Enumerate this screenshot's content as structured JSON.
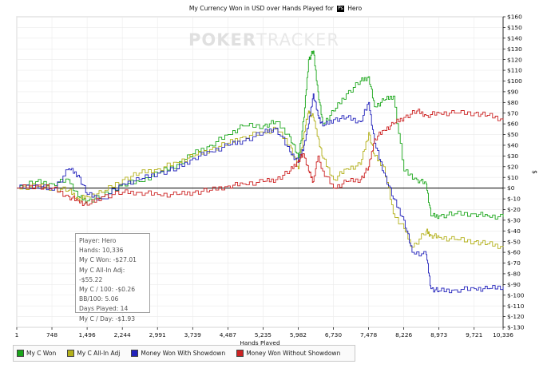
{
  "title": {
    "prefix": "My Currency Won in USD over Hands Played for",
    "player_tag": "Ps",
    "player": "Hero"
  },
  "watermark": {
    "bold": "POKER",
    "thin": "TRACKER"
  },
  "stats": {
    "player": "Player: Hero",
    "hands": "Hands: 10,336",
    "c_won": "My C Won: -$27.01",
    "allin_adj": "My C All-In Adj: -$55.22",
    "c_per_100": "My C / 100: -$0.26",
    "bb_100": "BB/100: 5.06",
    "days": "Days Played: 14",
    "c_per_day": "My C / Day: -$1.93"
  },
  "colors": {
    "green": "#1aa61a",
    "olive": "#b3b01a",
    "blue": "#2222bb",
    "red": "#cc2222",
    "grid": "#ebebeb",
    "axis": "#000000"
  },
  "chart_data": {
    "type": "line",
    "title": "My Currency Won in USD over Hands Played for Hero",
    "xlabel": "Hands Played",
    "ylabel": "$",
    "xlim": [
      1,
      10336
    ],
    "ylim": [
      -130,
      160
    ],
    "x_ticks": [
      "1",
      "748",
      "1,496",
      "2,244",
      "2,991",
      "3,739",
      "4,487",
      "5,235",
      "5,982",
      "6,730",
      "7,478",
      "8,226",
      "8,973",
      "9,721",
      "10,336"
    ],
    "y_ticks": [
      "$160",
      "$150",
      "$140",
      "$130",
      "$120",
      "$110",
      "$100",
      "$90",
      "$80",
      "$70",
      "$60",
      "$50",
      "$40",
      "$30",
      "$20",
      "$10",
      "$0",
      "$-10",
      "$-20",
      "$-30",
      "$-40",
      "$-50",
      "$-60",
      "$-70",
      "$-80",
      "$-90",
      "$-100",
      "$-110",
      "$-120",
      "$-130"
    ],
    "legend_position": "bottom",
    "series": [
      {
        "name": "My C Won",
        "color": "#1aa61a",
        "points": [
          [
            1,
            0
          ],
          [
            400,
            6
          ],
          [
            748,
            4
          ],
          [
            1100,
            8
          ],
          [
            1300,
            -8
          ],
          [
            1496,
            -12
          ],
          [
            1800,
            -8
          ],
          [
            2244,
            4
          ],
          [
            2600,
            6
          ],
          [
            2991,
            14
          ],
          [
            3400,
            22
          ],
          [
            3739,
            32
          ],
          [
            4100,
            40
          ],
          [
            4487,
            50
          ],
          [
            4800,
            58
          ],
          [
            5235,
            58
          ],
          [
            5500,
            62
          ],
          [
            5800,
            48
          ],
          [
            5982,
            28
          ],
          [
            6100,
            66
          ],
          [
            6200,
            120
          ],
          [
            6300,
            128
          ],
          [
            6400,
            90
          ],
          [
            6500,
            60
          ],
          [
            6730,
            72
          ],
          [
            7000,
            88
          ],
          [
            7300,
            100
          ],
          [
            7478,
            104
          ],
          [
            7600,
            76
          ],
          [
            7800,
            82
          ],
          [
            8000,
            86
          ],
          [
            8226,
            16
          ],
          [
            8500,
            8
          ],
          [
            8700,
            4
          ],
          [
            8800,
            -26
          ],
          [
            8973,
            -26
          ],
          [
            9300,
            -24
          ],
          [
            9721,
            -24
          ],
          [
            10000,
            -26
          ],
          [
            10336,
            -27
          ]
        ]
      },
      {
        "name": "My C All-In Adj",
        "color": "#b3b01a",
        "points": [
          [
            1,
            0
          ],
          [
            400,
            2
          ],
          [
            748,
            0
          ],
          [
            1100,
            -2
          ],
          [
            1300,
            -10
          ],
          [
            1496,
            -8
          ],
          [
            1800,
            -4
          ],
          [
            2244,
            8
          ],
          [
            2600,
            14
          ],
          [
            2991,
            18
          ],
          [
            3400,
            24
          ],
          [
            3739,
            30
          ],
          [
            4100,
            36
          ],
          [
            4487,
            42
          ],
          [
            4800,
            48
          ],
          [
            5235,
            52
          ],
          [
            5500,
            55
          ],
          [
            5800,
            40
          ],
          [
            5982,
            18
          ],
          [
            6100,
            52
          ],
          [
            6200,
            72
          ],
          [
            6300,
            66
          ],
          [
            6400,
            48
          ],
          [
            6500,
            28
          ],
          [
            6730,
            8
          ],
          [
            7000,
            18
          ],
          [
            7300,
            22
          ],
          [
            7478,
            52
          ],
          [
            7600,
            30
          ],
          [
            7800,
            20
          ],
          [
            8000,
            -24
          ],
          [
            8226,
            -38
          ],
          [
            8400,
            -55
          ],
          [
            8700,
            -40
          ],
          [
            8800,
            -44
          ],
          [
            8973,
            -46
          ],
          [
            9300,
            -48
          ],
          [
            9721,
            -50
          ],
          [
            10000,
            -52
          ],
          [
            10336,
            -55
          ]
        ]
      },
      {
        "name": "Money Won With Showdown",
        "color": "#2222bb",
        "points": [
          [
            1,
            0
          ],
          [
            400,
            3
          ],
          [
            748,
            -2
          ],
          [
            1100,
            18
          ],
          [
            1300,
            12
          ],
          [
            1496,
            -6
          ],
          [
            1800,
            -10
          ],
          [
            2244,
            4
          ],
          [
            2600,
            8
          ],
          [
            2991,
            14
          ],
          [
            3400,
            18
          ],
          [
            3739,
            28
          ],
          [
            4100,
            34
          ],
          [
            4487,
            40
          ],
          [
            4800,
            44
          ],
          [
            5235,
            52
          ],
          [
            5500,
            56
          ],
          [
            5800,
            34
          ],
          [
            5982,
            24
          ],
          [
            6100,
            40
          ],
          [
            6200,
            60
          ],
          [
            6300,
            88
          ],
          [
            6400,
            68
          ],
          [
            6500,
            58
          ],
          [
            6730,
            64
          ],
          [
            7000,
            66
          ],
          [
            7300,
            62
          ],
          [
            7478,
            80
          ],
          [
            7600,
            42
          ],
          [
            7800,
            14
          ],
          [
            8000,
            -10
          ],
          [
            8226,
            -30
          ],
          [
            8400,
            -60
          ],
          [
            8700,
            -62
          ],
          [
            8800,
            -94
          ],
          [
            8973,
            -96
          ],
          [
            9300,
            -95
          ],
          [
            9721,
            -94
          ],
          [
            10000,
            -94
          ],
          [
            10336,
            -92
          ]
        ]
      },
      {
        "name": "Money Won Without Showdown",
        "color": "#cc2222",
        "points": [
          [
            1,
            0
          ],
          [
            400,
            2
          ],
          [
            748,
            0
          ],
          [
            1100,
            -8
          ],
          [
            1300,
            -12
          ],
          [
            1496,
            -16
          ],
          [
            1800,
            -8
          ],
          [
            2244,
            -4
          ],
          [
            2600,
            -4
          ],
          [
            2991,
            -6
          ],
          [
            3400,
            -6
          ],
          [
            3739,
            -4
          ],
          [
            4100,
            -2
          ],
          [
            4487,
            2
          ],
          [
            4800,
            4
          ],
          [
            5235,
            6
          ],
          [
            5500,
            8
          ],
          [
            5800,
            16
          ],
          [
            5982,
            26
          ],
          [
            6100,
            32
          ],
          [
            6200,
            16
          ],
          [
            6300,
            6
          ],
          [
            6400,
            30
          ],
          [
            6500,
            16
          ],
          [
            6730,
            0
          ],
          [
            7000,
            6
          ],
          [
            7300,
            8
          ],
          [
            7478,
            20
          ],
          [
            7600,
            46
          ],
          [
            7800,
            54
          ],
          [
            8000,
            60
          ],
          [
            8226,
            66
          ],
          [
            8500,
            72
          ],
          [
            8700,
            68
          ],
          [
            8973,
            70
          ],
          [
            9300,
            70
          ],
          [
            9721,
            70
          ],
          [
            10000,
            68
          ],
          [
            10336,
            64
          ]
        ]
      }
    ]
  }
}
